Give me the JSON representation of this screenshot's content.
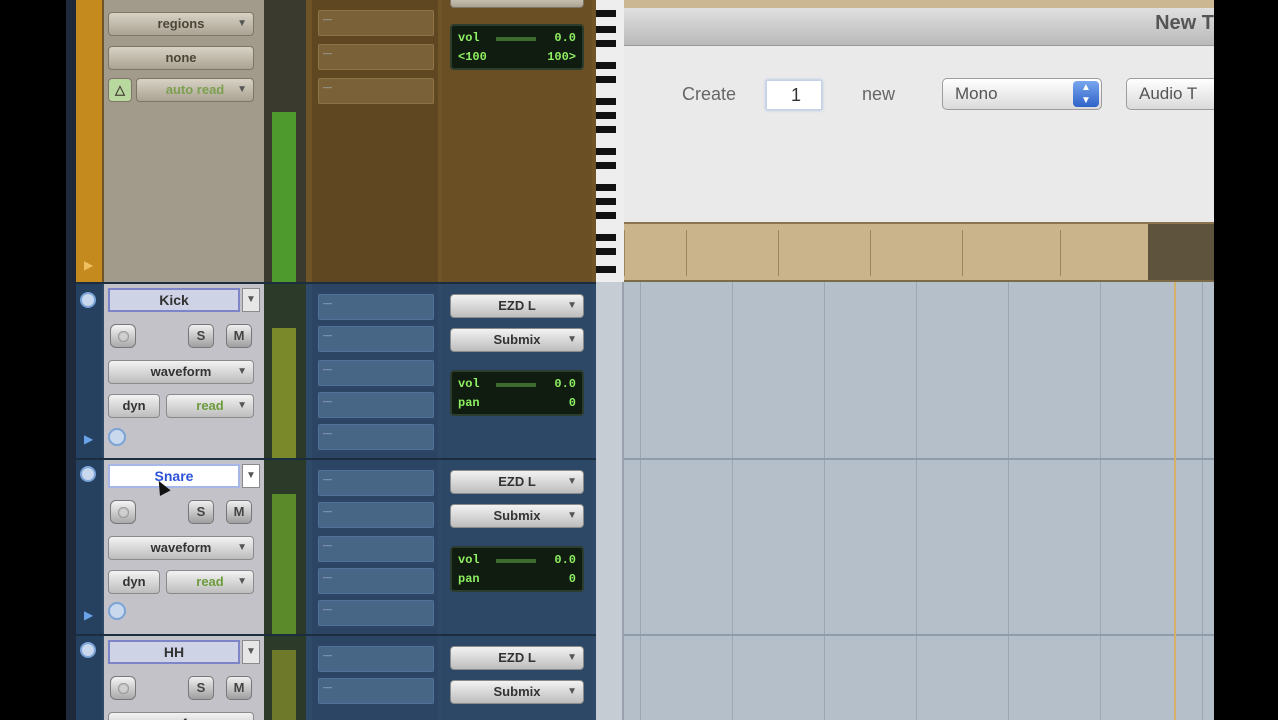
{
  "master_track": {
    "regions_label": "regions",
    "none_label": "none",
    "automation_label": "auto read",
    "vol_label": "vol",
    "vol_value": "0.0",
    "pan_left": "<100",
    "pan_right": "100>"
  },
  "tracks": [
    {
      "name": "Kick",
      "output": "EZD L",
      "bus": "Submix",
      "view": "waveform",
      "dyn": "dyn",
      "auto": "read",
      "solo": "S",
      "mute": "M",
      "vol_label": "vol",
      "vol_value": "0.0",
      "pan_label": "pan",
      "pan_value": "0"
    },
    {
      "name": "Snare",
      "output": "EZD L",
      "bus": "Submix",
      "view": "waveform",
      "dyn": "dyn",
      "auto": "read",
      "solo": "S",
      "mute": "M",
      "vol_label": "vol",
      "vol_value": "0.0",
      "pan_label": "pan",
      "pan_value": "0"
    },
    {
      "name": "HH",
      "output": "EZD L",
      "bus": "Submix",
      "view": "waveform",
      "solo": "S",
      "mute": "M"
    }
  ],
  "dialog": {
    "title": "New T",
    "create_label": "Create",
    "count_value": "1",
    "new_label": "new",
    "format_value": "Mono",
    "type_value": "Audio T"
  },
  "icons": {
    "dropdown": "chevron-down-icon",
    "record": "record-icon",
    "automation": "automation-icon",
    "expand": "triangle-right-icon"
  },
  "colors": {
    "master_lane": "#c58a1d",
    "track_blue": "#2f4a68",
    "meter_green": "#4e9a2c",
    "lcd_text": "#8ef062",
    "dialog_accent": "#2f63c8"
  }
}
